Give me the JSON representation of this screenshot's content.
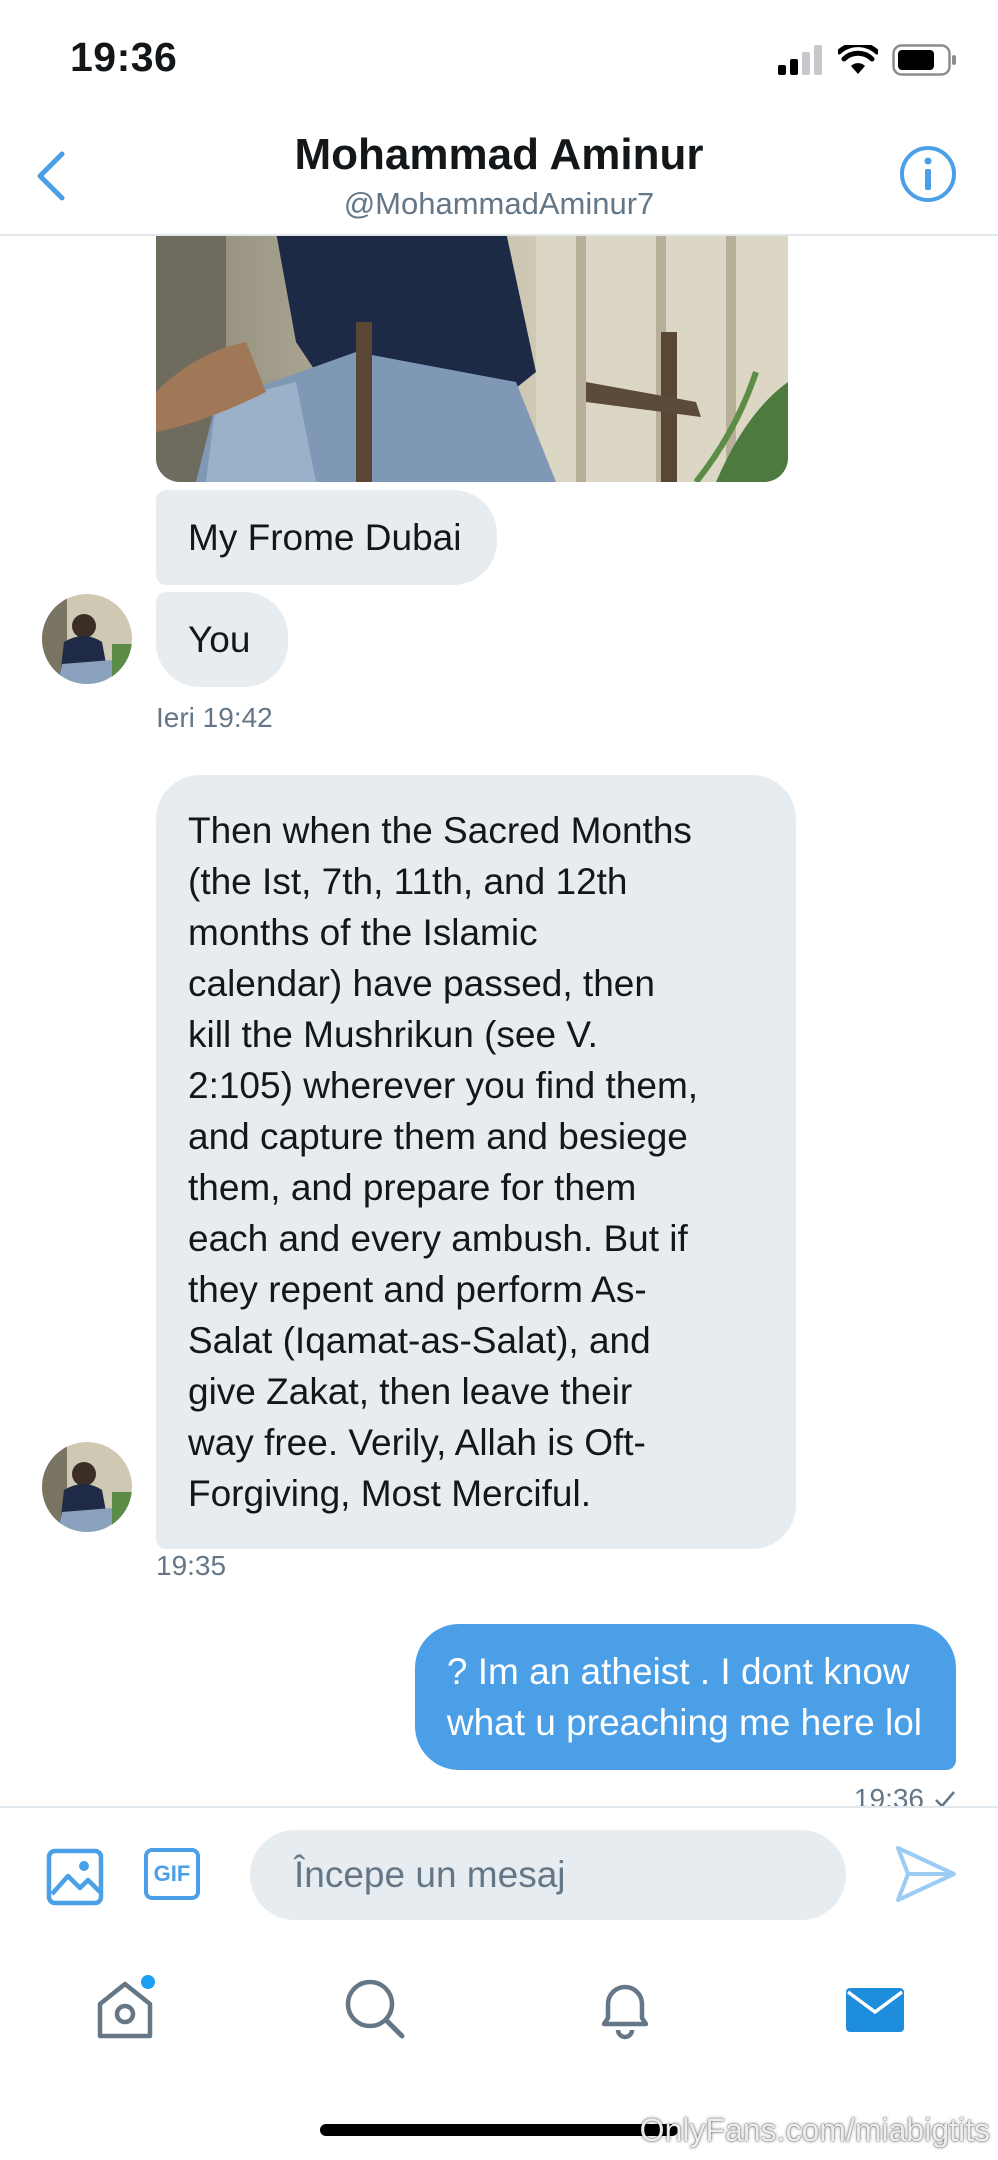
{
  "status_bar": {
    "time": "19:36"
  },
  "header": {
    "title": "Mohammad Aminur",
    "handle": "@MohammadAminur7"
  },
  "messages": [
    {
      "text": "My Frome Dubai"
    },
    {
      "text": "You"
    },
    {
      "text": "Then when the Sacred Months\n(the Ist, 7th, 11th, and 12th\nmonths of the Islamic\ncalendar) have passed, then\nkill the Mushrikun (see V.\n2:105) wherever you find them,\nand capture them and besiege\nthem, and prepare for them\neach and every ambush. But if\nthey repent and perform As-\nSalat (Iqamat-as-Salat), and\ngive Zakat, then leave their\nway free. Verily, Allah is Oft-\nForgiving, Most Merciful."
    },
    {
      "text": "? Im an atheist . I dont know\nwhat u preaching me here lol"
    }
  ],
  "timestamps": [
    "Ieri 19:42",
    "19:35",
    "19:36"
  ],
  "compose": {
    "gif_label": "GIF",
    "placeholder": "Începe un mesaj"
  },
  "watermark": "OnlyFans.com/miabigtits",
  "colors": {
    "accent": "#4a9fe7",
    "bubble_incoming": "#e6ecf0",
    "secondary_text": "#657786",
    "notification_dot": "#1da1f2"
  },
  "icons": {
    "back": "chevron-left-icon",
    "info": "info-icon",
    "media": "image-icon",
    "send": "send-icon",
    "tabs": [
      "home-icon",
      "search-icon",
      "bell-icon",
      "mail-icon"
    ]
  }
}
